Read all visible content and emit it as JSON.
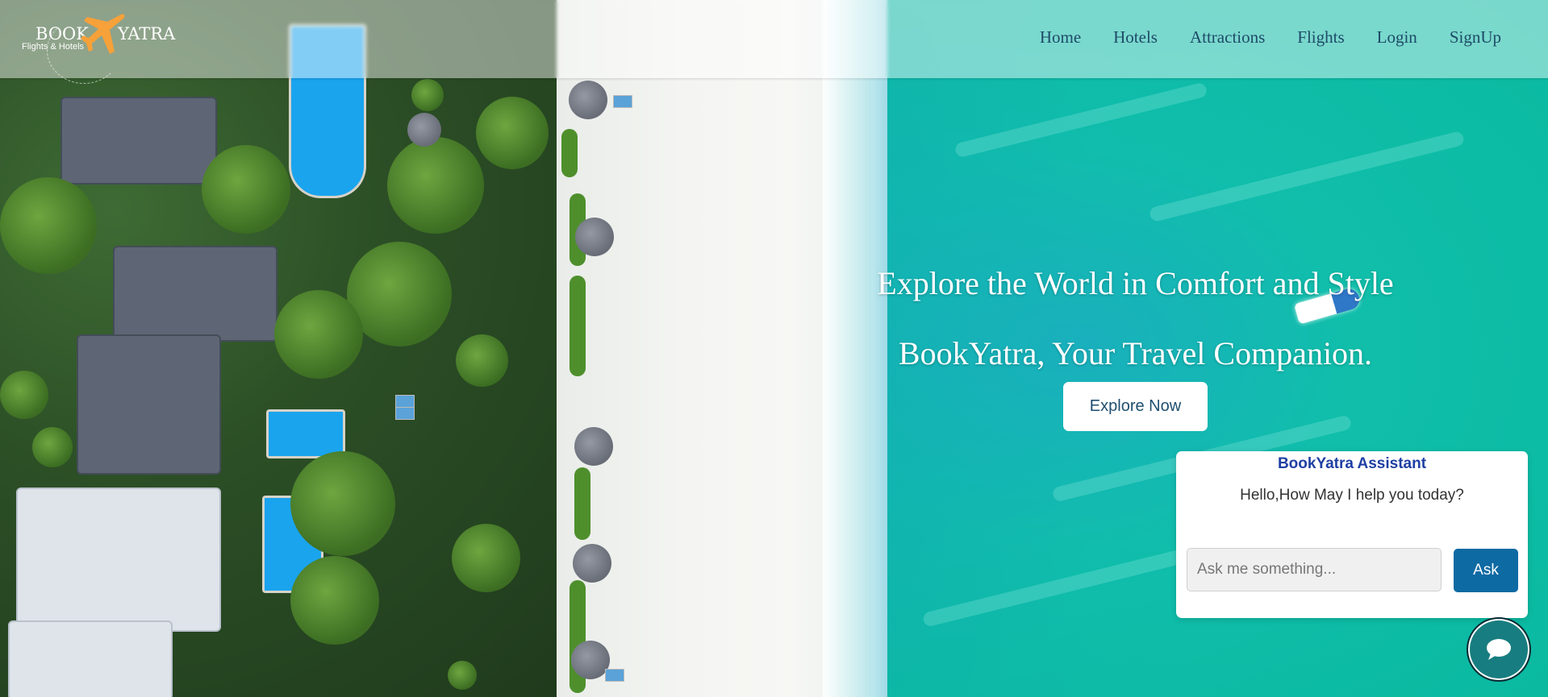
{
  "brand": {
    "name_left": "BOOK",
    "name_right": "YATRA",
    "tagline": "Flights & Hotels",
    "accent_color": "#f6a13a"
  },
  "nav": {
    "items": [
      {
        "label": "Home"
      },
      {
        "label": "Hotels"
      },
      {
        "label": "Attractions"
      },
      {
        "label": "Flights"
      },
      {
        "label": "Login"
      },
      {
        "label": "SignUp"
      }
    ]
  },
  "hero": {
    "title": "Explore the World in Comfort and Style",
    "subtitle": "BookYatra, Your Travel Companion.",
    "cta_label": "Explore Now"
  },
  "chat": {
    "title": "BookYatra Assistant",
    "greeting": "Hello,How May I help you today?",
    "input_placeholder": "Ask me something...",
    "input_value": "",
    "ask_label": "Ask",
    "title_color": "#1f3fa3",
    "button_color": "#0e6aa3",
    "toggle_icon": "chat-bubble-icon"
  }
}
